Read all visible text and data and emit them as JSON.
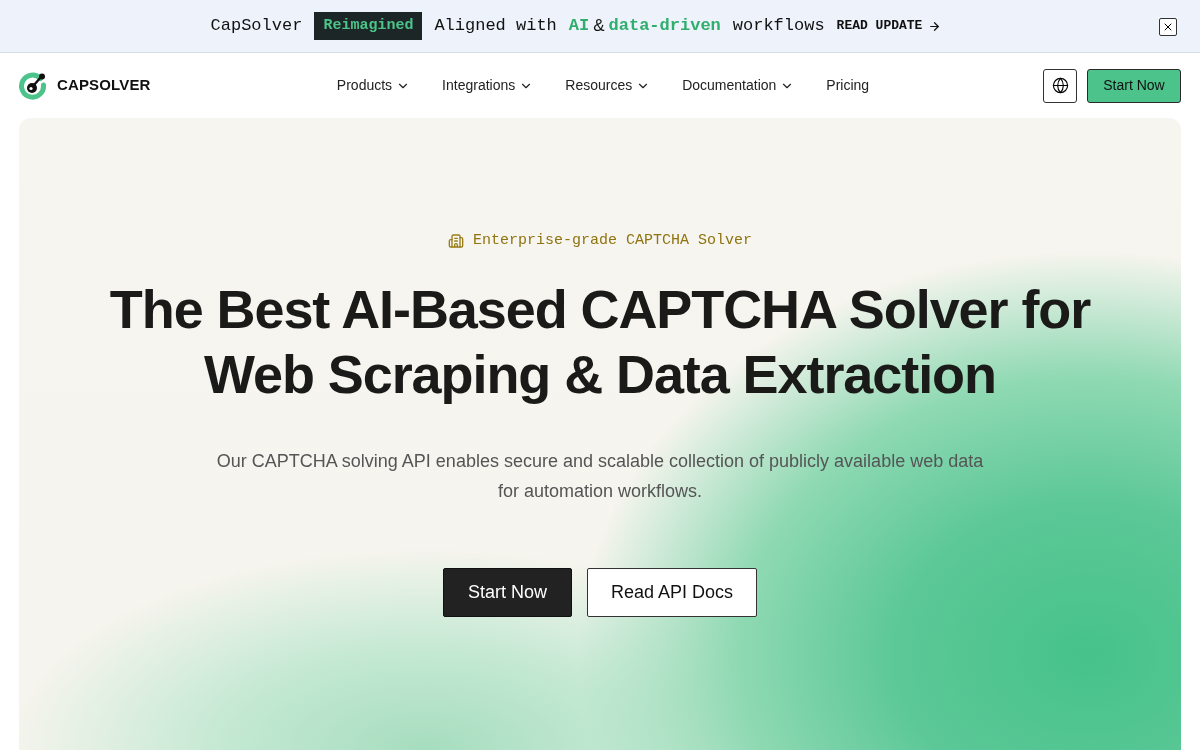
{
  "banner": {
    "segments": [
      {
        "text": "CapSolver",
        "kind": "plain"
      },
      {
        "text": "Reimagined",
        "kind": "tag"
      },
      {
        "text": "Aligned with",
        "kind": "plain"
      },
      {
        "text": "AI",
        "kind": "accent"
      },
      {
        "text": "&",
        "kind": "joiner"
      },
      {
        "text": "data-driven",
        "kind": "accent"
      },
      {
        "text": "workflows",
        "kind": "plain"
      }
    ],
    "link": "READ UPDATE"
  },
  "nav": {
    "logo": "CAPSOLVER",
    "items": [
      {
        "label": "Products",
        "dropdown": true
      },
      {
        "label": "Integrations",
        "dropdown": true
      },
      {
        "label": "Resources",
        "dropdown": true
      },
      {
        "label": "Documentation",
        "dropdown": true
      },
      {
        "label": "Pricing",
        "dropdown": false
      }
    ],
    "cta": "Start Now"
  },
  "hero": {
    "badge": "Enterprise-grade CAPTCHA Solver",
    "headline": "The Best AI-Based CAPTCHA Solver for Web Scraping & Data Extraction",
    "subtitle": "Our CAPTCHA solving API enables secure and scalable collection of publicly available web data for automation workflows.",
    "buttons": [
      {
        "label": "Start Now",
        "kind": "primary"
      },
      {
        "label": "Read API Docs",
        "kind": "secondary"
      }
    ]
  }
}
